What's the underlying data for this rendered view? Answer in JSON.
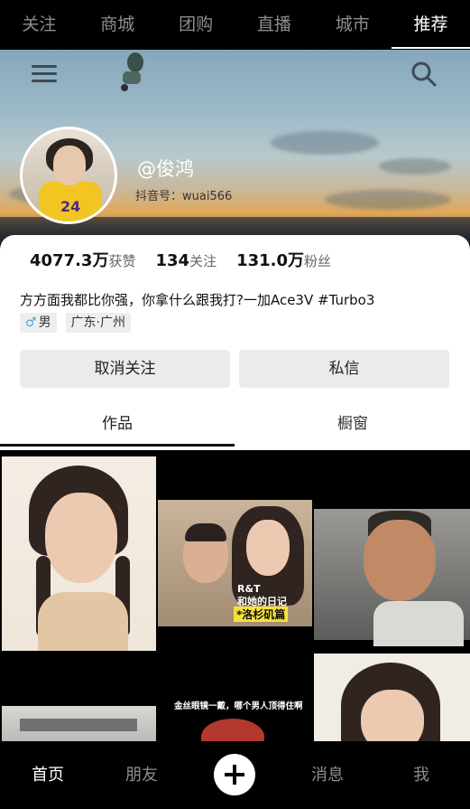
{
  "top_tabs": [
    "关注",
    "商城",
    "团购",
    "直播",
    "城市",
    "推荐"
  ],
  "active_top_tab": "推荐",
  "profile": {
    "username": "@俊鸿",
    "douyin_id": "抖音号：wuai566",
    "avatar_number": "24"
  },
  "stats": {
    "likes_value": "4077.3万",
    "likes_label": "获赞",
    "following_value": "134",
    "following_label": "关注",
    "followers_value": "131.0万",
    "followers_label": "粉丝"
  },
  "bio": "方方面我都比你强，你拿什么跟我打?一加Ace3V #Turbo3",
  "tags": {
    "gender_symbol": "♂",
    "gender": "男",
    "location": "广东·广州"
  },
  "buttons": {
    "unfollow": "取消关注",
    "message": "私信"
  },
  "content_tabs": {
    "works": "作品",
    "window": "橱窗"
  },
  "video_overlays": {
    "c2_line1": "R&T",
    "c2_line2": "和她的日记",
    "c2_line3": "*洛杉矶篇",
    "c5_caption": "金丝眼镜一戴，哪个男人顶得住啊"
  },
  "bottom_nav": {
    "home": "首页",
    "friends": "朋友",
    "messages": "消息",
    "me": "我"
  },
  "colors": {
    "accent_gender": "#3fa8e8",
    "overlay_yellow": "#f5e23a",
    "active_text": "#ffffff",
    "inactive_text": "#8d8d8d"
  }
}
